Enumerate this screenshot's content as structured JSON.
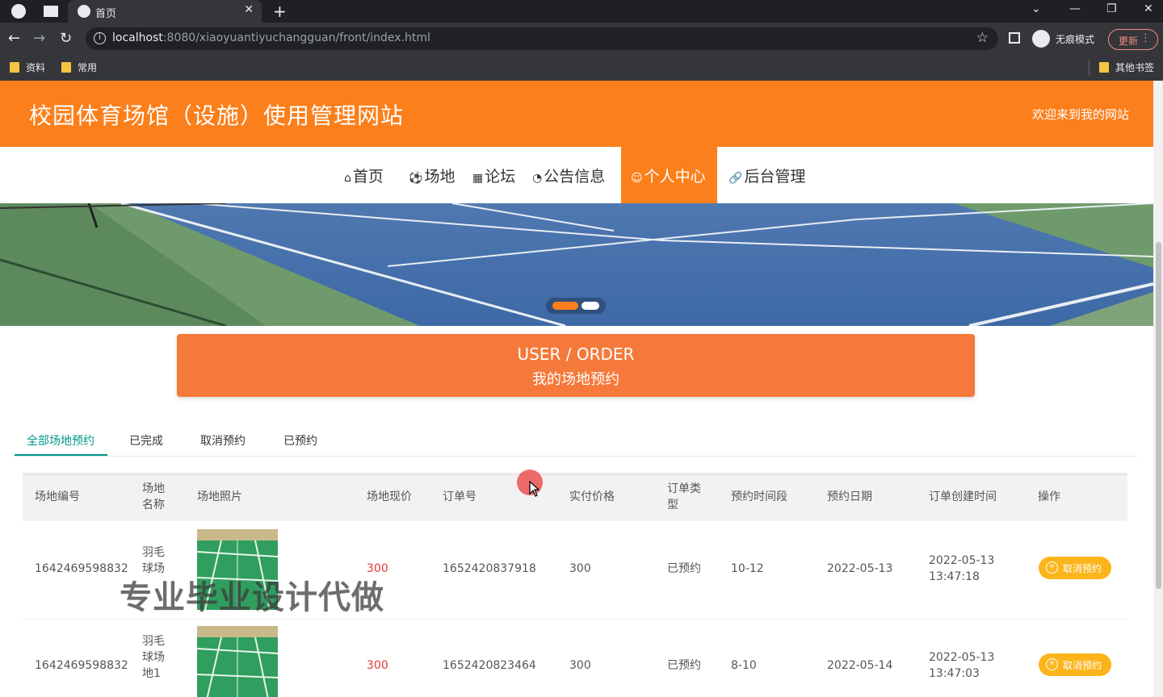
{
  "browser": {
    "tab_title": "首页",
    "url_host": "localhost",
    "url_path": ":8080/xiaoyuantiyuchangguan/front/index.html",
    "incognito_label": "无痕模式",
    "update_label": "更新",
    "bookmarks": [
      "资料",
      "常用"
    ],
    "other_bookmarks": "其他书签"
  },
  "site": {
    "title": "校园体育场馆（设施）使用管理网站",
    "welcome": "欢迎来到我的网站"
  },
  "nav": [
    {
      "icon": "⌂",
      "label": "首页"
    },
    {
      "icon": "⚽",
      "label": "场地"
    },
    {
      "icon": "▦",
      "label": "论坛"
    },
    {
      "icon": "◔",
      "label": "公告信息"
    },
    {
      "icon": "☺",
      "label": "个人中心"
    },
    {
      "icon": "🔗",
      "label": "后台管理"
    }
  ],
  "section": {
    "title_en": "USER / ORDER",
    "title_cn": "我的场地预约"
  },
  "filter_tabs": [
    "全部场地预约",
    "已完成",
    "取消预约",
    "已预约"
  ],
  "table": {
    "headers": {
      "id": "场地编号",
      "name_1": "场地",
      "name_2": "名称",
      "photo": "场地照片",
      "price": "场地现价",
      "order_no": "订单号",
      "paid": "实付价格",
      "type_1": "订单类",
      "type_2": "型",
      "slot": "预约时间段",
      "date": "预约日期",
      "created": "订单创建时间",
      "action": "操作"
    },
    "rows": [
      {
        "id": "1642469598832",
        "name_1": "羽毛",
        "name_2": "球场",
        "price": "300",
        "order_no": "1652420837918",
        "paid": "300",
        "type": "已预约",
        "slot": "10-12",
        "date": "2022-05-13",
        "created_1": "2022-05-13",
        "created_2": "13:47:18",
        "action": "取消预约"
      },
      {
        "id": "1642469598832",
        "name_1": "羽毛",
        "name_2": "球场",
        "name_3": "地1",
        "price": "300",
        "order_no": "1652420823464",
        "paid": "300",
        "type": "已预约",
        "slot": "8-10",
        "date": "2022-05-14",
        "created_1": "2022-05-13",
        "created_2": "13:47:03",
        "action": "取消预约"
      }
    ]
  },
  "watermark": "专业毕业设计代做",
  "colors": {
    "brand_orange": "#fb7f1b",
    "tab_active": "#009688",
    "price_red": "#e53935",
    "cancel_yellow": "#fbb51b"
  }
}
